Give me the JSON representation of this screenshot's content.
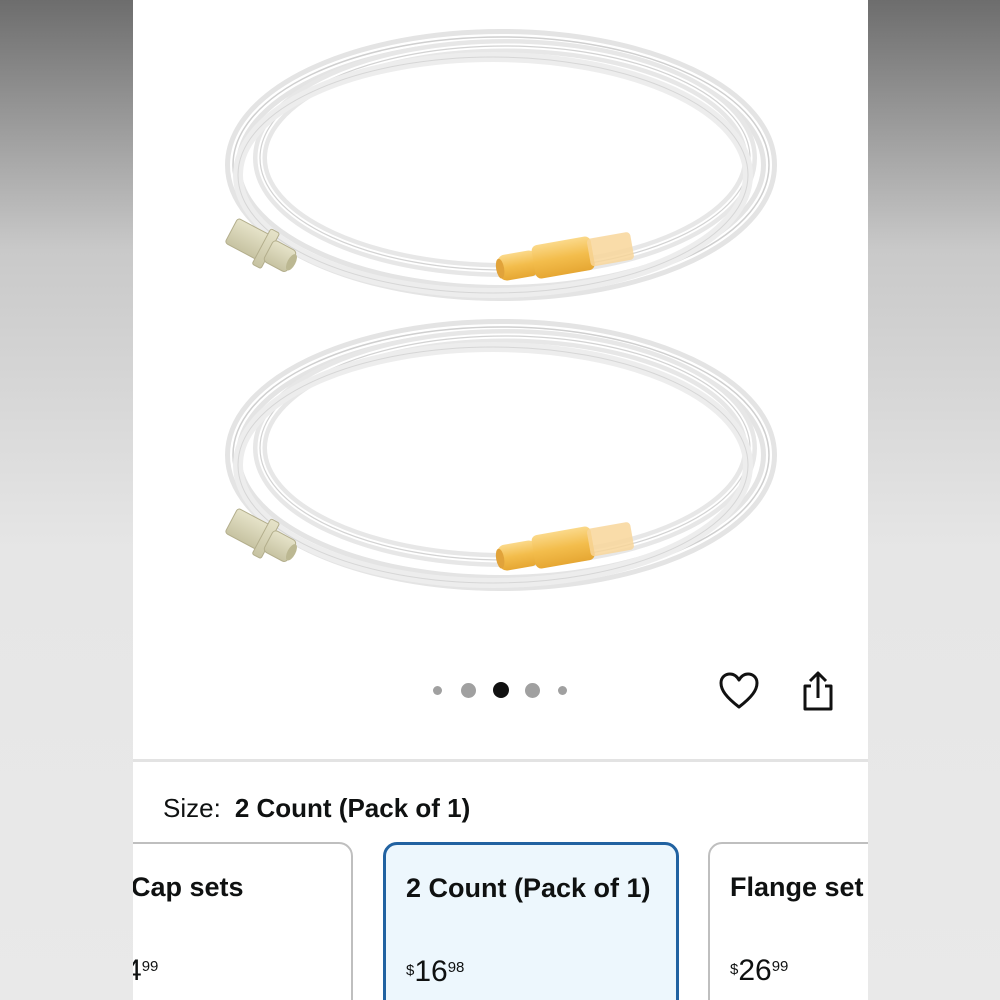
{
  "carousel": {
    "dot_count": 5,
    "active_index": 2
  },
  "actions": {
    "wishlist_icon": "heart-icon",
    "share_icon": "share-icon"
  },
  "size_selector": {
    "label": "Size:",
    "selected_value": "2 Count (Pack of 1)"
  },
  "variants": [
    {
      "title": "Cap sets",
      "price_symbol": "",
      "price_whole": "4",
      "price_fraction": "99",
      "selected": false
    },
    {
      "title": "2 Count (Pack of 1)",
      "price_symbol": "$",
      "price_whole": "16",
      "price_fraction": "98",
      "selected": true
    },
    {
      "title": "Flange set",
      "price_symbol": "$",
      "price_whole": "26",
      "price_fraction": "99",
      "selected": false
    }
  ],
  "colors": {
    "selected_border": "#2162a1",
    "selected_bg": "#edf7fd",
    "connector_yellow": "#f5c658",
    "connector_beige": "#d9d6b8"
  }
}
